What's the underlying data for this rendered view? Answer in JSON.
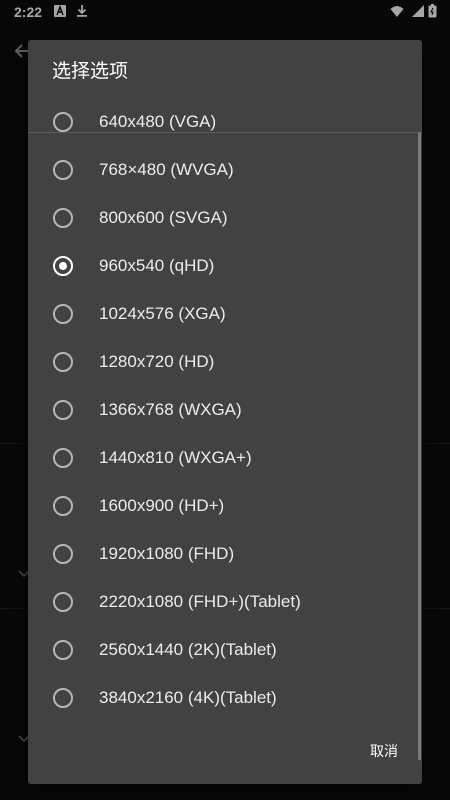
{
  "status_bar": {
    "time": "2:22"
  },
  "dialog": {
    "title": "选择选项",
    "cancel_label": "取消",
    "options": [
      {
        "label": "640x480 (VGA)",
        "selected": false
      },
      {
        "label": "768×480 (WVGA)",
        "selected": false
      },
      {
        "label": "800x600 (SVGA)",
        "selected": false
      },
      {
        "label": "960x540 (qHD)",
        "selected": true
      },
      {
        "label": "1024x576 (XGA)",
        "selected": false
      },
      {
        "label": "1280x720 (HD)",
        "selected": false
      },
      {
        "label": "1366x768 (WXGA)",
        "selected": false
      },
      {
        "label": "1440x810 (WXGA+)",
        "selected": false
      },
      {
        "label": "1600x900 (HD+)",
        "selected": false
      },
      {
        "label": "1920x1080 (FHD)",
        "selected": false
      },
      {
        "label": "2220x1080 (FHD+)(Tablet)",
        "selected": false
      },
      {
        "label": "2560x1440 (2K)(Tablet)",
        "selected": false
      },
      {
        "label": "3840x2160 (4K)(Tablet)",
        "selected": false
      }
    ]
  },
  "colors": {
    "dialog_background": "#424242",
    "text": "#ececec",
    "radio_unchecked": "#b6b6b6",
    "radio_checked": "#ffffff"
  }
}
